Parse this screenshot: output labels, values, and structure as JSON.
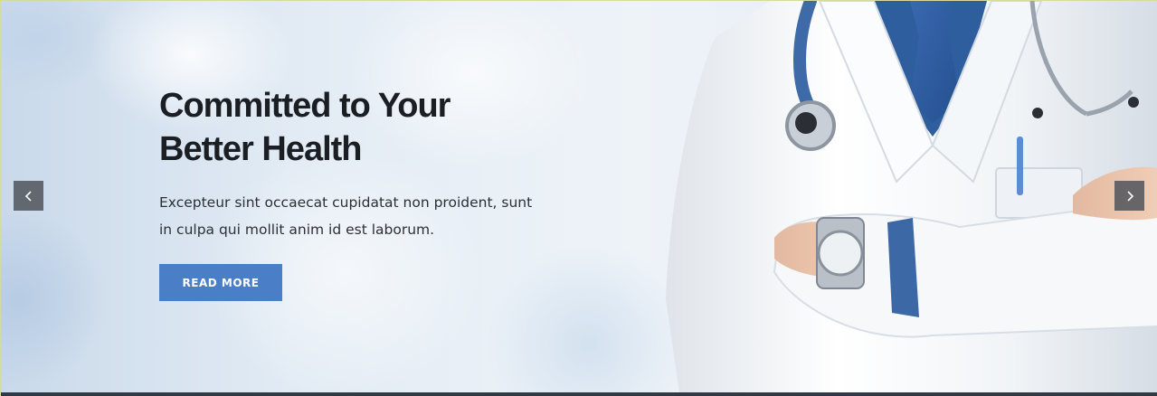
{
  "hero": {
    "title_line1": "Committed to Your",
    "title_line2": "Better Health",
    "desc_line1": "Excepteur sint occaecat cupidatat non proident, sunt",
    "desc_line2": "in culpa qui mollit anim id est laborum.",
    "button_label": "READ MORE"
  },
  "icons": {
    "prev": "chevron-left-icon",
    "next": "chevron-right-icon"
  },
  "colors": {
    "accent": "#4a7fc8",
    "title": "#1b1e22",
    "text": "#2c3036",
    "arrow_bg": "#50545a",
    "coat": "#f4f6f8",
    "tie": "#3f6fb8",
    "shirt": "#2f5e9e"
  }
}
